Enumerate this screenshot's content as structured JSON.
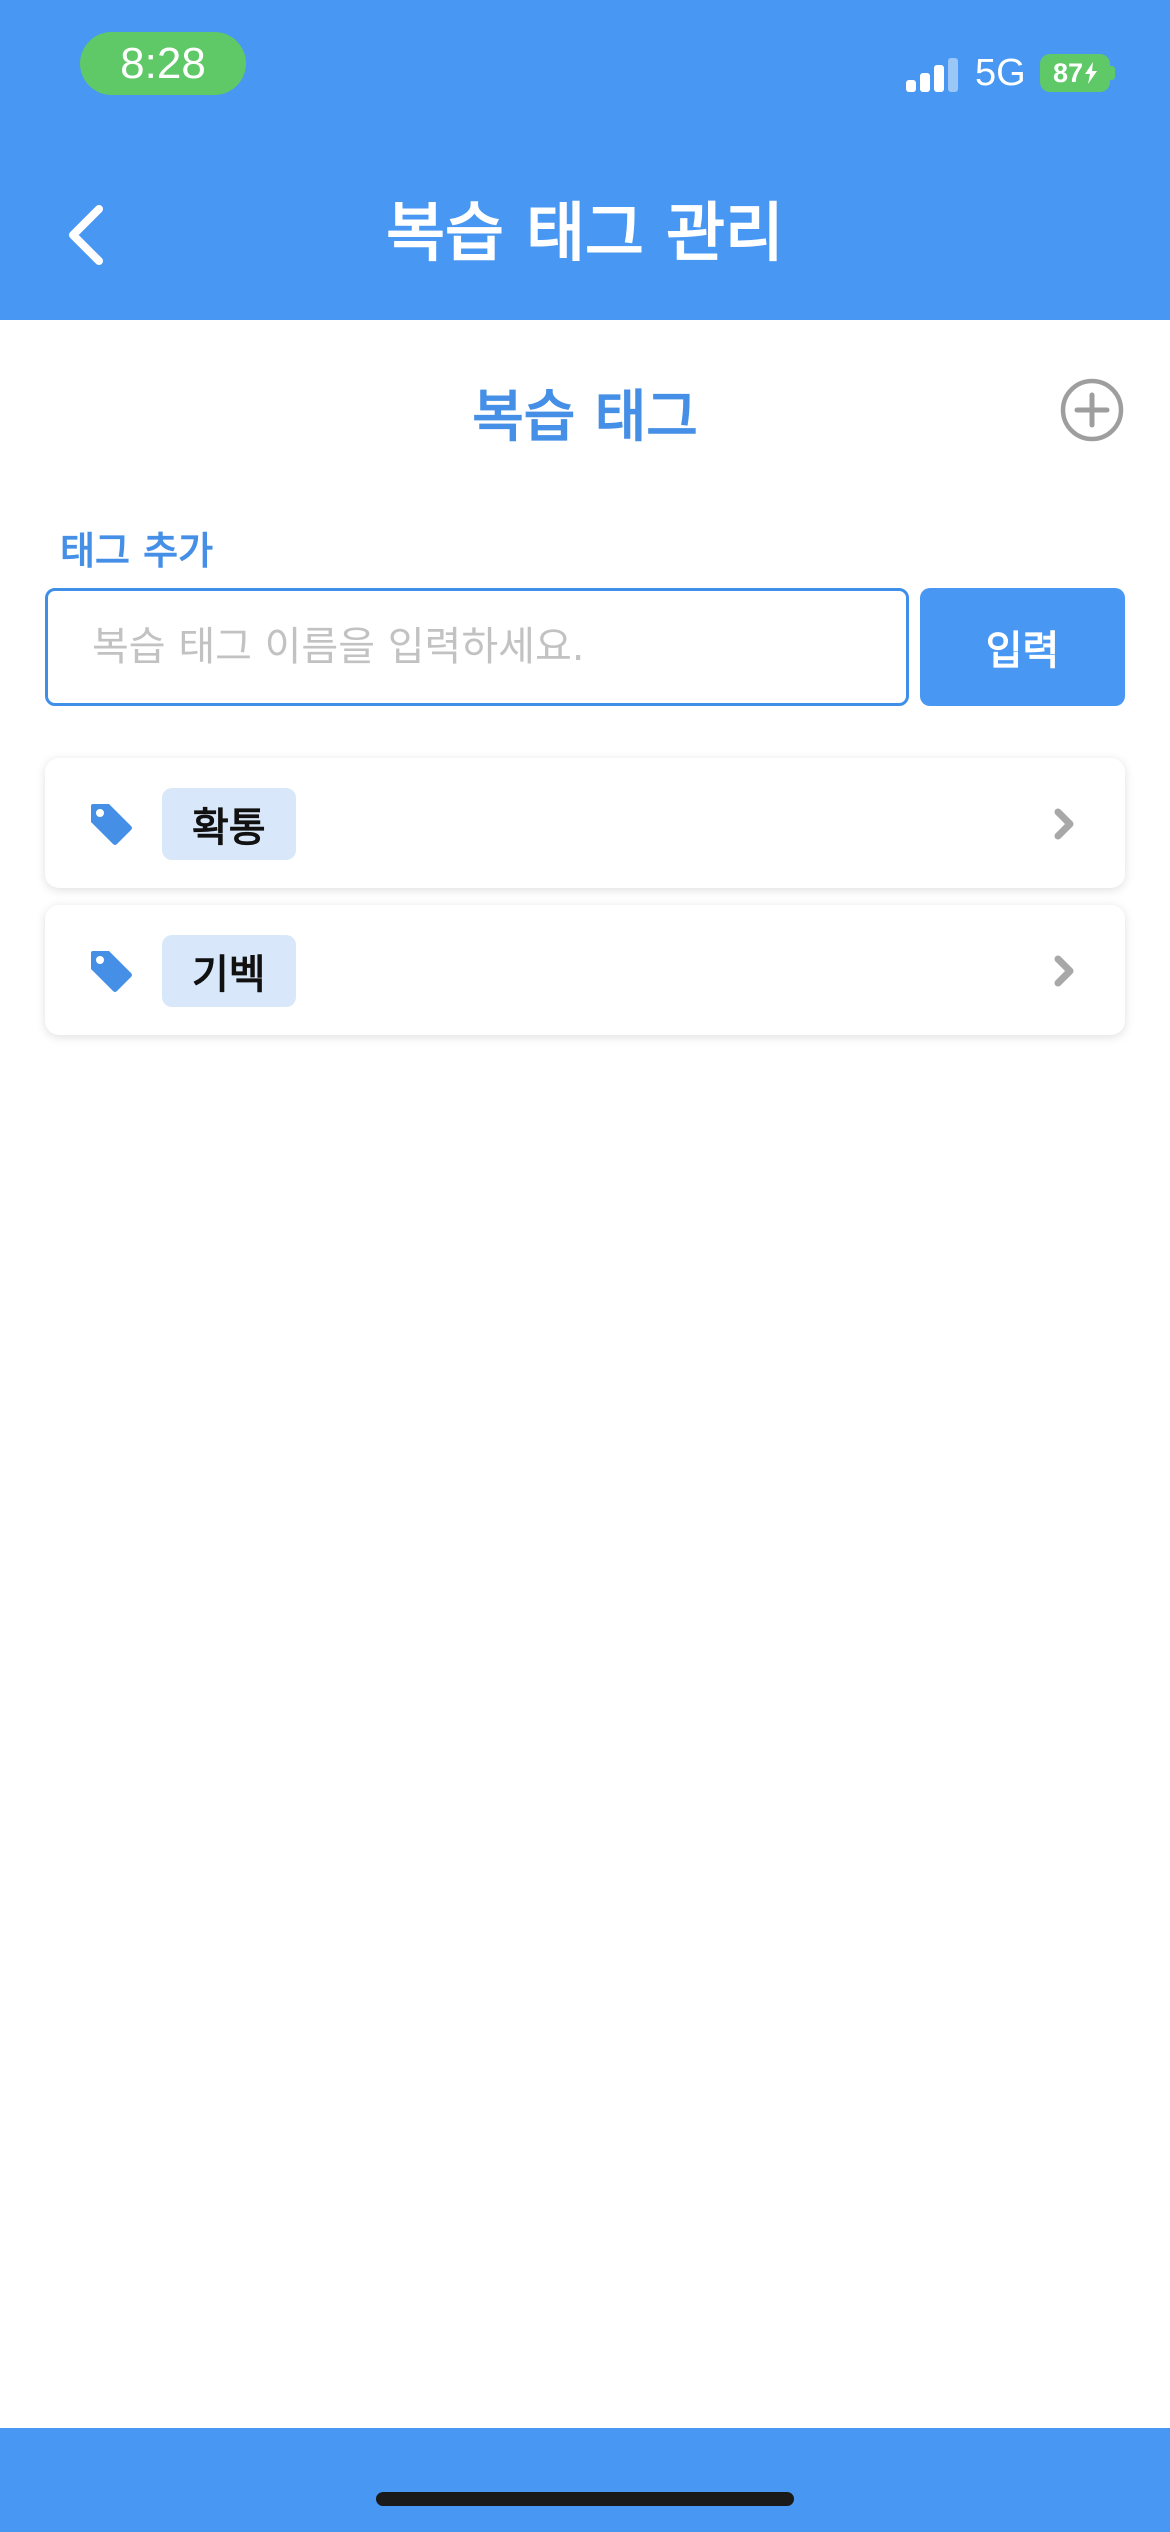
{
  "status_bar": {
    "time": "8:28",
    "network": "5G",
    "battery": "87",
    "icons": [
      "signal-icon",
      "battery-icon"
    ],
    "bar_color": "#4897f2",
    "time_pill_color": "#5fc867"
  },
  "nav": {
    "title": "복습 태그 관리",
    "back_icon": "chevron-left-icon"
  },
  "section": {
    "title": "복습 태그",
    "add_icon": "plus-circle-icon"
  },
  "add_form": {
    "label": "태그 추가",
    "input_value": "",
    "placeholder": "복습 태그 이름을 입력하세요.",
    "submit_label": "입력"
  },
  "tags": [
    {
      "name": "확통",
      "icon": "tag-icon",
      "chevron": "chevron-right-icon"
    },
    {
      "name": "기벡",
      "icon": "tag-icon",
      "chevron": "chevron-right-icon"
    }
  ],
  "colors": {
    "accent": "#4897f2",
    "label_blue": "#4590e6",
    "chip_bg": "#d8e8fa"
  }
}
